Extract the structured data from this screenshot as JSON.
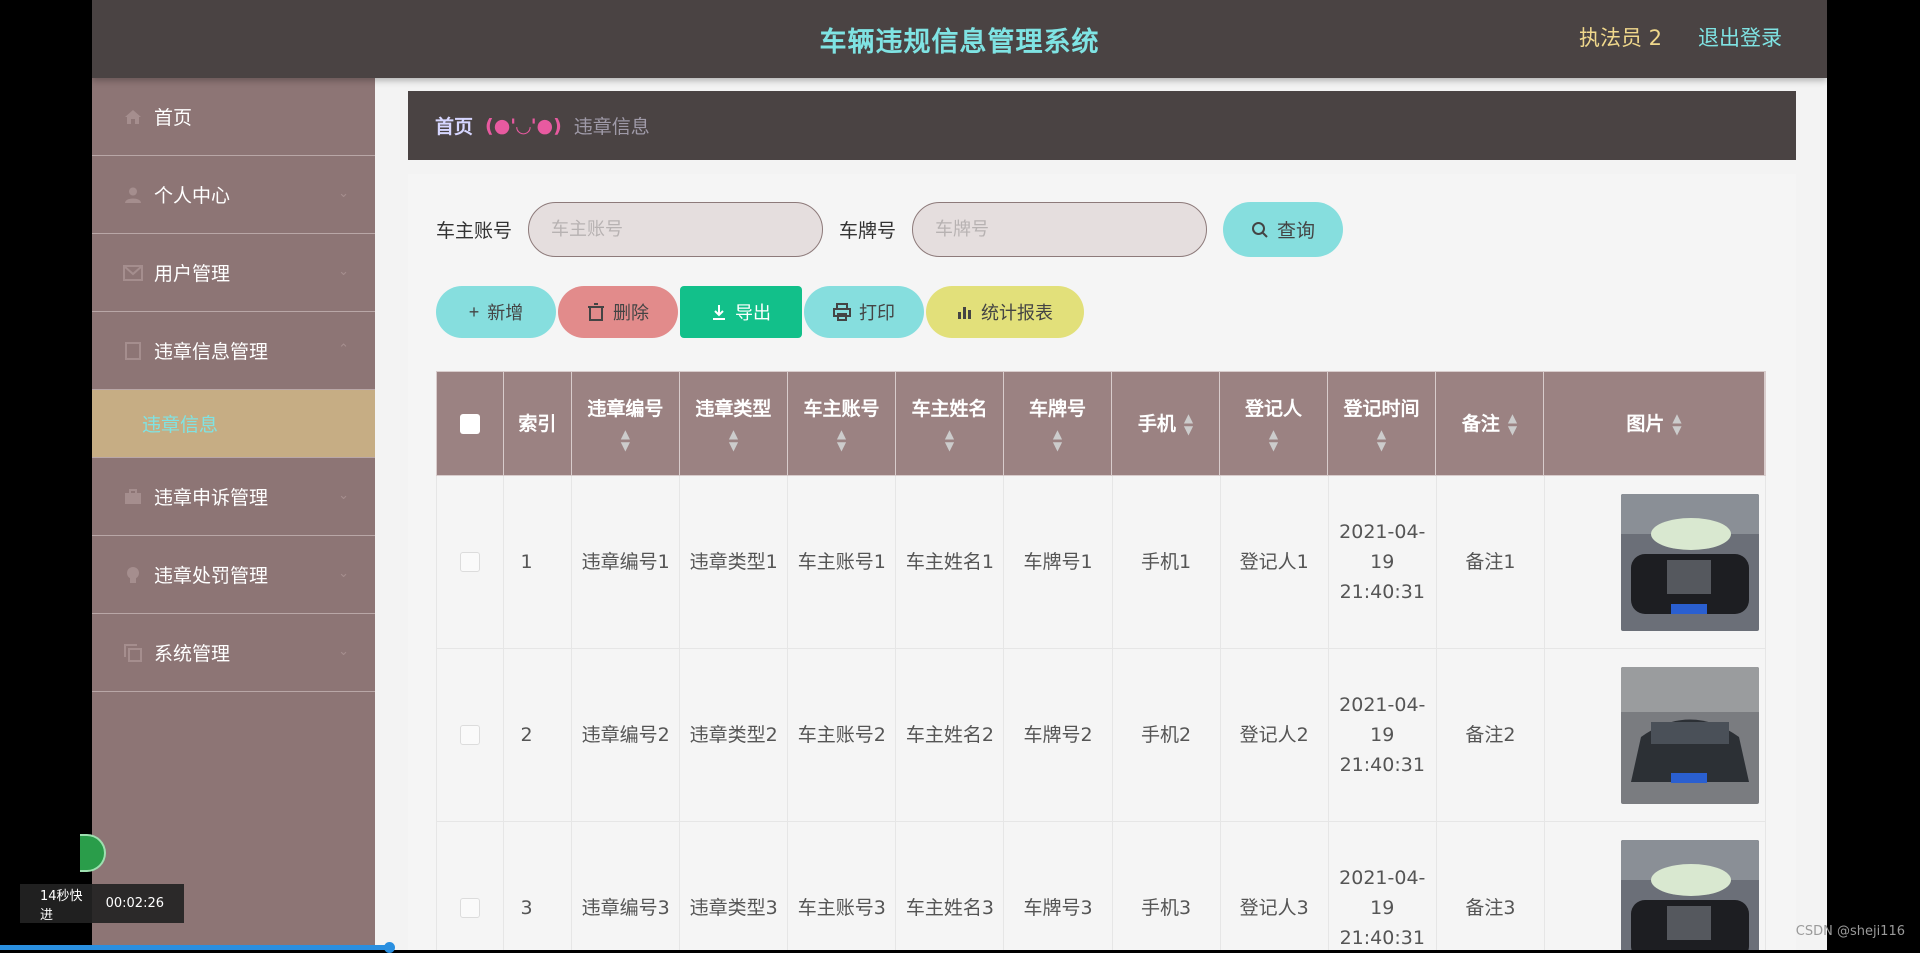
{
  "header": {
    "title": "车辆违规信息管理系统",
    "user": "执法员 2",
    "logout": "退出登录"
  },
  "sidebar": {
    "items": [
      {
        "label": "首页",
        "icon": "home-icon"
      },
      {
        "label": "个人中心",
        "icon": "user-icon"
      },
      {
        "label": "用户管理",
        "icon": "mail-icon"
      },
      {
        "label": "违章信息管理",
        "icon": "doc-icon"
      },
      {
        "label": "违章申诉管理",
        "icon": "briefcase-icon"
      },
      {
        "label": "违章处罚管理",
        "icon": "bulb-icon"
      },
      {
        "label": "系统管理",
        "icon": "copy-icon"
      }
    ],
    "active_sub": "违章信息"
  },
  "breadcrumb": {
    "home": "首页",
    "separator": "(●'◡'●)",
    "current": "违章信息"
  },
  "search": {
    "owner_label": "车主账号",
    "owner_placeholder": "车主账号",
    "plate_label": "车牌号",
    "plate_placeholder": "车牌号",
    "button": "查询"
  },
  "actions": {
    "add": "新增",
    "delete": "删除",
    "export": "导出",
    "print": "打印",
    "stats": "统计报表"
  },
  "table": {
    "headers": [
      "索引",
      "违章编号",
      "违章类型",
      "车主账号",
      "车主姓名",
      "车牌号",
      "手机",
      "登记人",
      "登记时间",
      "备注",
      "图片"
    ],
    "rows": [
      {
        "index": "1",
        "code": "违章编号1",
        "type": "违章类型1",
        "owner": "车主账号1",
        "name": "车主姓名1",
        "plate": "车牌号1",
        "phone": "手机1",
        "registrar": "登记人1",
        "time": "2021-04-19 21:40:31",
        "note": "备注1"
      },
      {
        "index": "2",
        "code": "违章编号2",
        "type": "违章类型2",
        "owner": "车主账号2",
        "name": "车主姓名2",
        "plate": "车牌号2",
        "phone": "手机2",
        "registrar": "登记人2",
        "time": "2021-04-19 21:40:31",
        "note": "备注2"
      },
      {
        "index": "3",
        "code": "违章编号3",
        "type": "违章类型3",
        "owner": "车主账号3",
        "name": "车主姓名3",
        "plate": "车牌号3",
        "phone": "手机3",
        "registrar": "登记人3",
        "time": "2021-04-19 21:40:31",
        "note": "备注3"
      }
    ]
  },
  "overlay": {
    "skip": "14秒快进",
    "time": "00:02:26",
    "watermark": "CSDN @sheji116"
  },
  "colors": {
    "header_bg": "#4a4343",
    "sidebar_bg": "#8d7575",
    "accent": "#7fe3e3",
    "active_bg": "#c6ad84"
  }
}
